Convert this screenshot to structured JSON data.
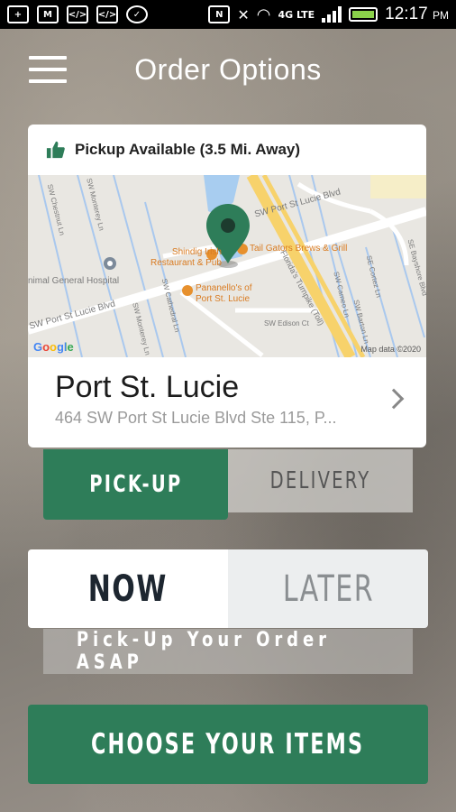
{
  "status_bar": {
    "time": "12:17",
    "ampm": "PM",
    "network": "4G LTE"
  },
  "header": {
    "title": "Order Options"
  },
  "location_card": {
    "availability": "Pickup Available (3.5 Mi. Away)",
    "store_name": "Port St. Lucie",
    "address": "464 SW Port St Lucie Blvd Ste 115, P...",
    "map": {
      "labels": {
        "street_top": "SW Port St Lucie Blvd",
        "street_left": "SW Port St Lucie Blvd",
        "hospital": "nimal General Hospital",
        "florida_tpk": "Florida's Turnpike (Toll)",
        "sw_edison": "SW Edison Ct",
        "se_bayshore": "SE Bayshore Blvd",
        "sw_chestnut": "SW Chestnut Ln",
        "sw_monterey_1": "SW Monterey Ln",
        "sw_monterey_2": "SW Monterey Ln",
        "sw_cathedral": "SW Cathedral Ln",
        "sw_cameo": "SW Cameo Ln",
        "sw_barton": "SW Barton Ln",
        "se_cortez": "SE Cortez Ln"
      },
      "pois": {
        "shindig": "Shindig Irish\nRestaurant & Pub",
        "tailgaters": "Tail Gators Brews & Grill",
        "pananellos": "Pananello's of\nPort St. Lucie"
      },
      "attribution": "Map data ©2020",
      "google_logo": "Google"
    }
  },
  "order_mode": {
    "pickup_label": "PICK-UP",
    "delivery_label": "DELIVERY",
    "selected": "PICK-UP"
  },
  "order_time": {
    "now_label": "NOW",
    "later_label": "LATER",
    "selected": "NOW",
    "hint": "Pick-Up Your Order ASAP"
  },
  "cta": {
    "label": "CHOOSE YOUR ITEMS"
  },
  "colors": {
    "accent": "#2e7d59",
    "pin": "#2e7d59"
  }
}
